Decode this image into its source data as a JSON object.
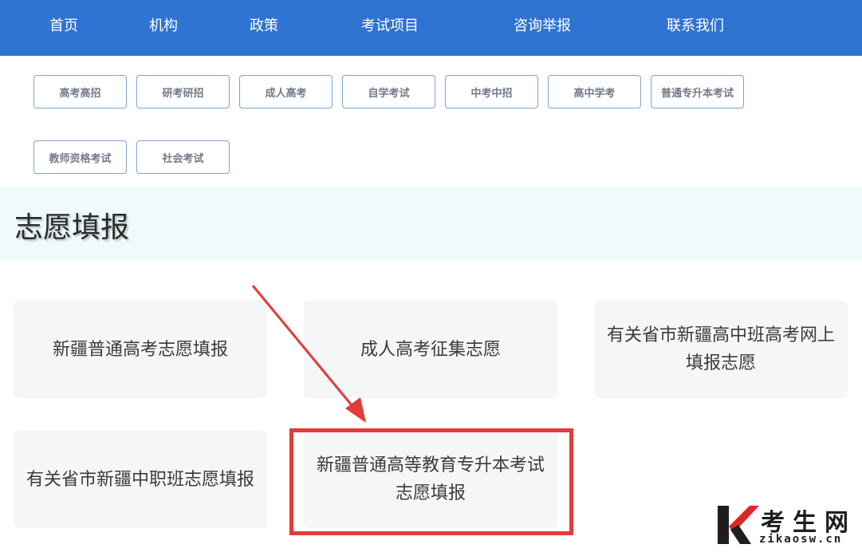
{
  "nav": {
    "items": [
      {
        "label": "首页"
      },
      {
        "label": "机构"
      },
      {
        "label": "政策"
      },
      {
        "label": "考试项目"
      },
      {
        "label": "咨询举报"
      },
      {
        "label": "联系我们"
      }
    ]
  },
  "categories": [
    {
      "label": "高考高招"
    },
    {
      "label": "研考研招"
    },
    {
      "label": "成人高考"
    },
    {
      "label": "自学考试"
    },
    {
      "label": "中考中招"
    },
    {
      "label": "高中学考"
    },
    {
      "label": "普通专升本考试"
    },
    {
      "label": "教师资格考试"
    },
    {
      "label": "社会考试"
    }
  ],
  "section": {
    "title": "志愿填报"
  },
  "cards": [
    {
      "label": "新疆普通高考志愿填报"
    },
    {
      "label": "成人高考征集志愿"
    },
    {
      "label": "有关省市新疆高中班高考网上填报志愿"
    },
    {
      "label": "有关省市新疆中职班志愿填报"
    },
    {
      "label": "新疆普通高等教育专升本考试志愿填报"
    }
  ],
  "watermark": {
    "cn": "考生网",
    "en": "zikaosw.cn",
    "colors": {
      "accent": "#e02525",
      "dark": "#1e1e1e"
    }
  },
  "colors": {
    "nav_bg": "#2f73d3",
    "highlight": "#e23b3b",
    "band_bg": "#effafc"
  }
}
